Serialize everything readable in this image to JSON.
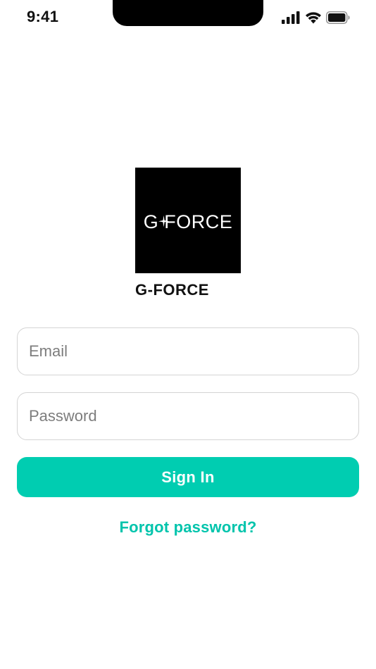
{
  "status_bar": {
    "time": "9:41",
    "icons": [
      "signal-icon",
      "wifi-icon",
      "battery-icon"
    ]
  },
  "logo": {
    "text": "G-FORCE",
    "name": "G-FORCE"
  },
  "form": {
    "email_placeholder": "Email",
    "email_value": "",
    "password_placeholder": "Password",
    "password_value": "",
    "signin_label": "Sign In",
    "forgot_label": "Forgot password?"
  },
  "colors": {
    "accent": "#00cdb1",
    "link": "#00c4ac",
    "input_border": "#d4d4d4",
    "placeholder": "#7d7d7d"
  }
}
